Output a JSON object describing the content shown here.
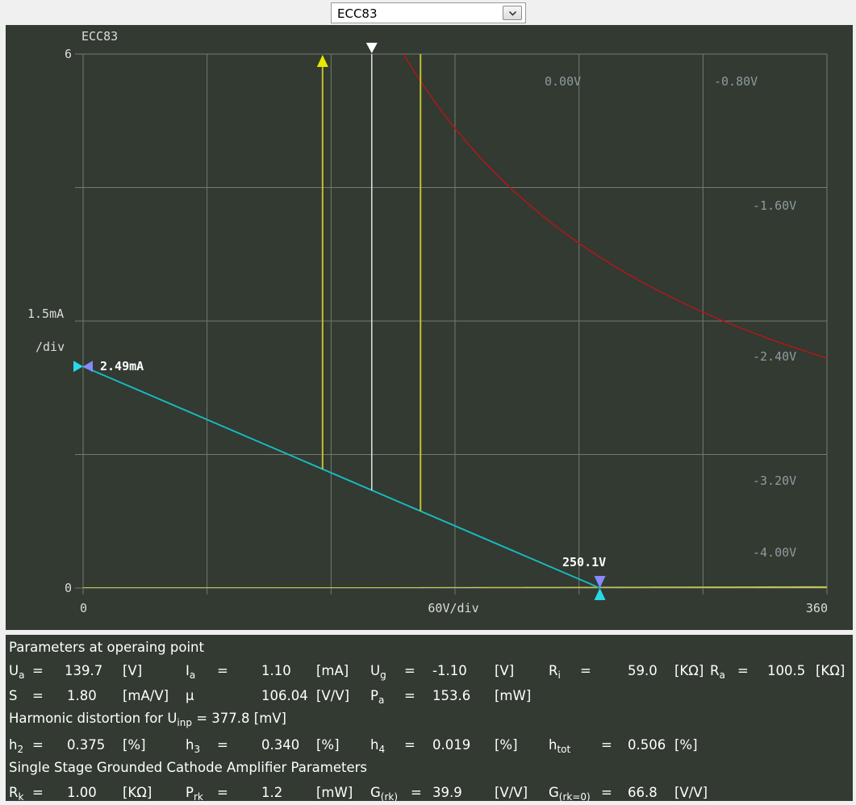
{
  "selector": {
    "value": "ECC83"
  },
  "plot": {
    "title": "ECC83",
    "y_top_label": "6",
    "y_bottom_label": "0",
    "y_scale_label_1": "1.5mA",
    "y_scale_label_2": "/div",
    "x_left_label": "0",
    "x_mid_label": "60V/div",
    "x_right_label": "360",
    "current_marker_label": "2.49mA",
    "voltage_marker_label": "250.1V",
    "grid_curve_labels": [
      "0.00V",
      "-0.80V",
      "-1.60V",
      "-2.40V",
      "-3.20V",
      "-4.00V"
    ],
    "colors": {
      "background": "#323a32",
      "grid": "#737a73",
      "curve": "#5c7c8c",
      "highlight": "#c0c030",
      "operating": "#e6e6e6",
      "load_line": "#18b8c0",
      "power_limit": "#b01818",
      "marker": "#28d8e8",
      "marker_alt": "#8888ff"
    },
    "chart_data": {
      "type": "line",
      "x_range": [
        0,
        360
      ],
      "y_range": [
        0,
        6
      ],
      "x_unit": "V",
      "y_unit": "mA",
      "grid_voltages": [
        0,
        -0.8,
        -1.6,
        -2.4,
        -3.2,
        -4.0
      ],
      "operating_point": {
        "Ua": 139.7,
        "Ia": 1.1,
        "Ug": -1.1
      },
      "load_line": {
        "x": [
          0,
          250.1
        ],
        "y": [
          2.49,
          0
        ]
      },
      "power_limit_mW": 1000
    }
  },
  "params": {
    "header": "Parameters at operaing point",
    "row1": [
      {
        "sym": "U",
        "sub": "a",
        "eq": "=",
        "val": "139.7",
        "unit": "[V]"
      },
      {
        "sym": "I",
        "sub": "a",
        "eq": "=",
        "val": "1.10",
        "unit": "[mA]"
      },
      {
        "sym": "U",
        "sub": "g",
        "eq": "=",
        "val": "-1.10",
        "unit": "[V]"
      },
      {
        "sym": "R",
        "sub": "i",
        "eq": "=",
        "val": "59.0",
        "unit": "[KΩ]"
      },
      {
        "sym": "R",
        "sub": "a",
        "eq": "=",
        "val": "100.5",
        "unit": "[KΩ]"
      }
    ],
    "row2": [
      {
        "sym": "S",
        "sub": "",
        "eq": "=",
        "val": "1.80",
        "unit": "[mA/V]"
      },
      {
        "sym": "μ",
        "sub": "",
        "eq": "",
        "val": "106.04",
        "unit": "[V/V]"
      },
      {
        "sym": "P",
        "sub": "a",
        "eq": "=",
        "val": "153.6",
        "unit": "[mW]"
      }
    ],
    "harm_header_a": "Harmonic distortion for U",
    "harm_header_sub": "inp",
    "harm_header_b": " = 377.8 [mV]",
    "row3": [
      {
        "sym": "h",
        "sub": "2",
        "eq": "=",
        "val": "0.375",
        "unit": "[%]"
      },
      {
        "sym": "h",
        "sub": "3",
        "eq": "=",
        "val": "0.340",
        "unit": "[%]"
      },
      {
        "sym": "h",
        "sub": "4",
        "eq": "=",
        "val": "0.019",
        "unit": "[%]"
      },
      {
        "sym": "h",
        "sub": "tot",
        "eq": "=",
        "val": "0.506",
        "unit": "[%]"
      }
    ],
    "amp_header": "Single Stage Grounded Cathode Amplifier Parameters",
    "row4": [
      {
        "sym": "R",
        "sub": "k",
        "eq": "=",
        "val": "1.00",
        "unit": "[KΩ]"
      },
      {
        "sym": "P",
        "sub": "rk",
        "eq": "=",
        "val": "1.2",
        "unit": "[mW]"
      },
      {
        "sym": "G",
        "sub": "(rk)",
        "eq": "=",
        "val": "39.9",
        "unit": "[V/V]"
      },
      {
        "sym": "G",
        "sub": "(rk=0)",
        "eq": "=",
        "val": "66.8",
        "unit": "[V/V]"
      }
    ]
  }
}
